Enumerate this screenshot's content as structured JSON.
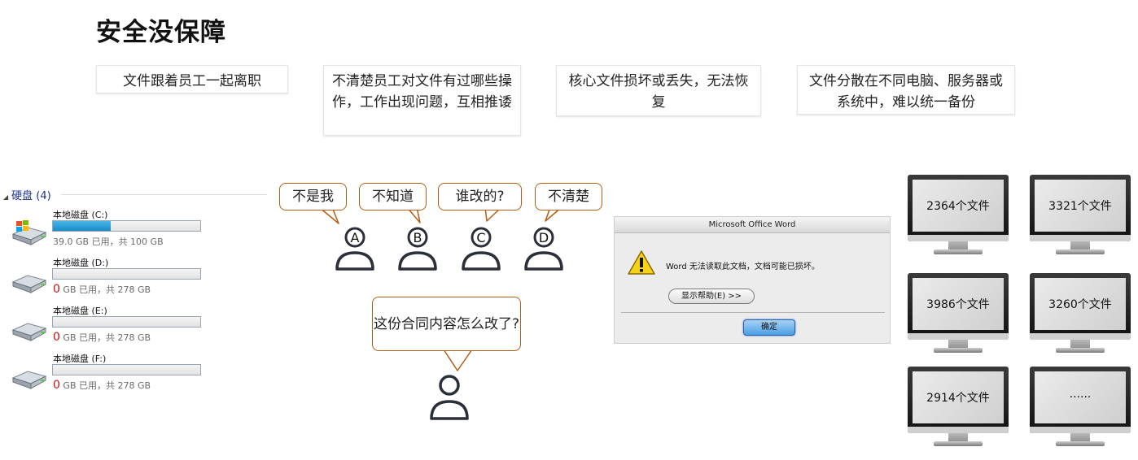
{
  "title": "安全没保障",
  "cards": [
    "文件跟着员工一起离职",
    "不清楚员工对文件有过哪些操作，工作出现问题，互相推诿",
    "核心文件损坏或丢失，无法恢复",
    "文件分散在不同电脑、服务器或系统中，难以统一备份"
  ],
  "drives": {
    "header": "硬盘 (4)",
    "items": [
      {
        "name": "本地磁盘 (C:)",
        "used_pct": 39,
        "used_label": "39.0",
        "info": " GB 已用，共 100 GB",
        "red": false
      },
      {
        "name": "本地磁盘 (D:)",
        "used_pct": 0,
        "used_label": "0",
        "info": " GB 已用，共 278 GB",
        "red": true
      },
      {
        "name": "本地磁盘 (E:)",
        "used_pct": 0,
        "used_label": "0",
        "info": " GB 已用，共 278 GB",
        "red": true
      },
      {
        "name": "本地磁盘 (F:)",
        "used_pct": 0,
        "used_label": "0",
        "info": " GB 已用，共 278 GB",
        "red": true
      }
    ]
  },
  "people": {
    "bubbles": [
      "不是我",
      "不知道",
      "谁改的?",
      "不清楚"
    ],
    "labels": [
      "A",
      "B",
      "C",
      "D"
    ],
    "boss_bubble": "这份合同内容怎么改了?"
  },
  "dialog": {
    "title": "Microsoft Office Word",
    "message": "Word 无法读取此文档，文档可能已损坏。",
    "help_button": "显示帮助(E) >>",
    "ok_button": "确定"
  },
  "monitors": [
    "2364个文件",
    "3321个文件",
    "3986个文件",
    "3260个文件",
    "2914个文件",
    "······"
  ],
  "colors": {
    "bubble_border": "#b65d13",
    "person_stroke": "#2b2f3a"
  }
}
